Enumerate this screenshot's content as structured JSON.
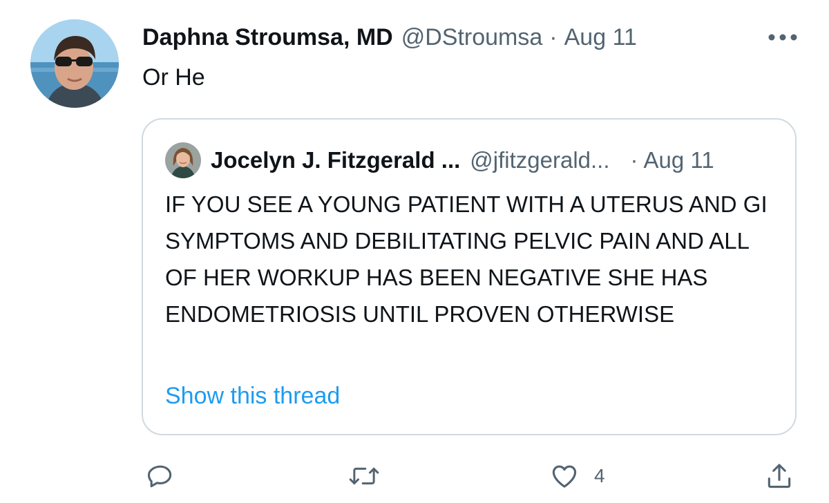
{
  "tweet": {
    "display_name": "Daphna Stroumsa, MD",
    "handle": "@DStroumsa",
    "separator": "·",
    "timestamp": "Aug 11",
    "text": "Or He",
    "avatar_icon": "profile-photo-sunglasses"
  },
  "quoted_tweet": {
    "display_name": "Jocelyn J. Fitzgerald ...",
    "handle": "@jfitzgerald...",
    "separator": "·",
    "timestamp": "Aug 11",
    "text": "IF YOU SEE A YOUNG PATIENT WITH A UTERUS AND GI SYMPTOMS AND DEBILITATING PELVIC PAIN AND ALL OF HER WORKUP HAS BEEN NEGATIVE SHE HAS ENDOMETRIOSIS UNTIL PROVEN OTHERWISE",
    "show_thread_label": "Show this thread",
    "avatar_icon": "profile-photo-portrait"
  },
  "actions": {
    "reply_icon": "reply-icon",
    "retweet_icon": "retweet-icon",
    "like_icon": "heart-icon",
    "like_count": "4",
    "share_icon": "share-icon",
    "more_icon": "more-dots-icon"
  },
  "colors": {
    "text_primary": "#0f1419",
    "text_secondary": "#536471",
    "link": "#1d9bf0",
    "border": "#cfd9de",
    "icon": "#536471"
  }
}
